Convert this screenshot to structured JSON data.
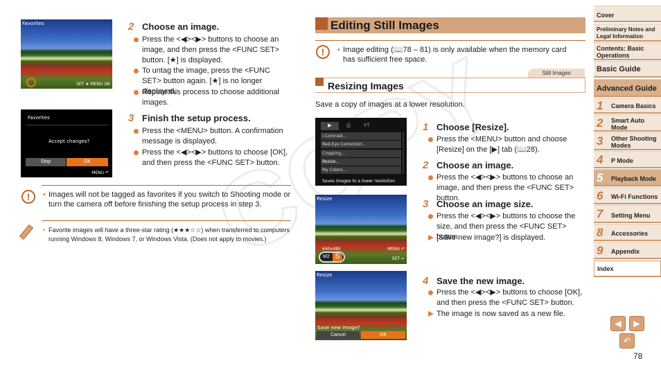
{
  "left": {
    "screen1": {
      "label": "Favorites",
      "footer": "SET ★ MENU OK"
    },
    "screen2": {
      "label": "Favorites",
      "question": "Accept changes?",
      "stop": "Stop",
      "ok": "OK",
      "footer": "MENU ↶"
    },
    "step2": {
      "num": "2",
      "title": "Choose an image.",
      "bullets": [
        "Press the <◀><▶> buttons to choose an image, and then press the <FUNC SET> button. [★] is displayed.",
        "To untag the image, press the <FUNC SET> button again. [★] is no longer displayed.",
        "Repeat this process to choose additional images."
      ]
    },
    "step3": {
      "num": "3",
      "title": "Finish the setup process.",
      "bullets": [
        "Press the <MENU> button. A confirmation message is displayed.",
        "Press the <◀><▶> buttons to choose [OK], and then press the <FUNC SET> button."
      ]
    },
    "caution": "Images will not be tagged as favorites if you switch to Shooting mode or turn the camera off before finishing the setup process in step 3.",
    "memo": "Favorite images will have a three-star rating (★★★☆☆) when transferred to computers running Windows 8, Windows 7, or Windows Vista. (Does not apply to movies.)"
  },
  "right": {
    "section_title": "Editing Still Images",
    "caution": "Image editing (📖78 – 81) is only available when the memory card has sufficient free space.",
    "tag": "Still Images",
    "sub_title": "Resizing Images",
    "intro": "Save a copy of images at a lower resolution.",
    "menu_screen": {
      "items": [
        "i-Contrast...",
        "Red-Eye Correction...",
        "Cropping...",
        "Resize...",
        "My Colors..."
      ],
      "selected": "Resize...",
      "hint": "Saves images to a lower resolution"
    },
    "resize_screen": {
      "label": "Resize",
      "size": "640x480",
      "m2": "M2",
      "s": "S",
      "menu": "MENU ↶",
      "set": "SET ↵"
    },
    "save_screen": {
      "label": "Resize",
      "question": "Save new image?",
      "cancel": "Cancel",
      "ok": "OK"
    },
    "steps": [
      {
        "num": "1",
        "title": "Choose [Resize].",
        "bullets": [
          "Press the <MENU> button and choose [Resize] on the [▶] tab (📖28)."
        ],
        "results": []
      },
      {
        "num": "2",
        "title": "Choose an image.",
        "bullets": [
          "Press the <◀><▶> buttons to choose an image, and then press the <FUNC SET> button."
        ],
        "results": []
      },
      {
        "num": "3",
        "title": "Choose an image size.",
        "bullets": [
          "Press the <◀><▶> buttons to choose the size, and then press the <FUNC SET> button."
        ],
        "results": [
          "[Save new image?] is displayed."
        ]
      },
      {
        "num": "4",
        "title": "Save the new image.",
        "bullets": [
          "Press the <◀><▶> buttons to choose [OK], and then press the <FUNC SET> button."
        ],
        "results": [
          "The image is now saved as a new file."
        ]
      }
    ]
  },
  "sidebar": {
    "items": [
      {
        "label": "Cover"
      },
      {
        "label": "Preliminary Notes and Legal Information"
      },
      {
        "label": "Contents: Basic Operations"
      },
      {
        "label": "Basic Guide"
      },
      {
        "label": "Advanced Guide"
      },
      {
        "num": "1",
        "label": "Camera Basics"
      },
      {
        "num": "2",
        "label": "Smart Auto Mode"
      },
      {
        "num": "3",
        "label": "Other Shooting Modes"
      },
      {
        "num": "4",
        "label": "P Mode"
      },
      {
        "num": "5",
        "label": "Playback Mode"
      },
      {
        "num": "6",
        "label": "Wi-Fi Functions"
      },
      {
        "num": "7",
        "label": "Setting Menu"
      },
      {
        "num": "8",
        "label": "Accessories"
      },
      {
        "num": "9",
        "label": "Appendix"
      },
      {
        "label": "Index"
      }
    ],
    "active": "Playback Mode"
  },
  "nav": {
    "prev": "◀",
    "next": "▶",
    "back": "↶"
  },
  "page_number": "78",
  "watermark": "COPY"
}
